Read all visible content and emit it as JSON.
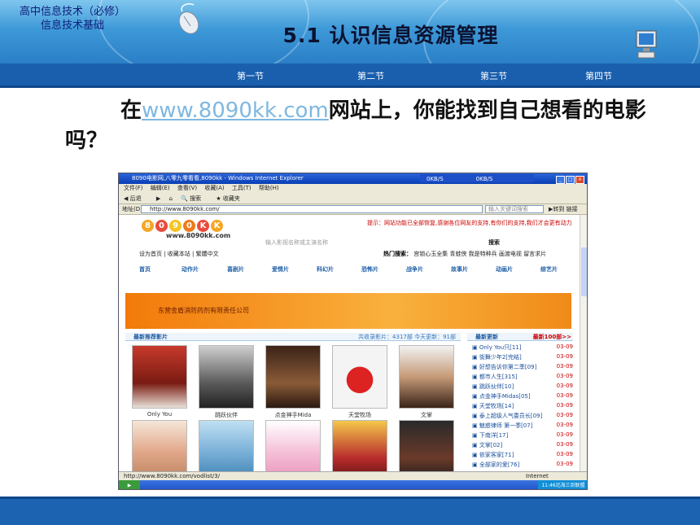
{
  "header": {
    "course_line1": "高中信息技术（必修）",
    "course_line2": "信息技术基础",
    "title": "5.1 认识信息资源管理"
  },
  "nav": [
    "第一节",
    "第二节",
    "第三节",
    "第四节"
  ],
  "question": {
    "before": "在",
    "link": "www.8090kk.com",
    "after": "网站上，你能找到自己想看的电影吗？"
  },
  "browser": {
    "window_title": "8090电影网,八零九零看看,8090kk - Windows Internet Explorer",
    "speed_a": "0KB/S",
    "speed_b": "0KB/S",
    "menu": [
      "文件(F)",
      "编辑(E)",
      "查看(V)",
      "收藏(A)",
      "工具(T)",
      "帮助(H)"
    ],
    "toolbar": [
      "后退",
      "搜索",
      "收藏夹"
    ],
    "address_label": "地址(D)",
    "url": "http://www.8090kk.com/",
    "search_placeholder": "输入关键词搜索",
    "go_label": "转到",
    "links_label": "链接",
    "status_url": "http://www.8090kk.com/vodlist/3/",
    "status_zone": "Internet",
    "clock": "11:46北海三剑联盟"
  },
  "site": {
    "domain": "www.8090kk.com",
    "search_placeholder": "输入影视名称或主演名称",
    "search_button": "搜索",
    "tip": "提示：网站功能已全部恢复,感谢各位网友的支持,有你们的支持,我们才会更有动力",
    "subnav": "设为首页 | 收藏本站 | 繁體中文",
    "hot_label": "热门搜索：",
    "hot_items": "宫锁心玉全集  青蛙侠  我是特种兵  画渡电视  留言求片",
    "categories": [
      "首页",
      "动作片",
      "喜剧片",
      "爱情片",
      "科幻片",
      "恐怖片",
      "战争片",
      "故事片",
      "动画片",
      "综艺片"
    ],
    "banner_text": "东营金盾消防药剂有限责任公司",
    "rec_title": "最新推荐影片",
    "rec_stats": "共收录影片：4317部  今天更新：91部",
    "news_title": "最新更新",
    "news_more": "最新100部>>",
    "films": [
      "Only You",
      "跳跃伙伴",
      "点金神手Mida",
      "天堂牧场",
      "文掌"
    ],
    "news": [
      {
        "t": "Only You只[11]",
        "d": "03-09"
      },
      {
        "t": "街舞少年2[完结]",
        "d": "03-09"
      },
      {
        "t": "好想告诉你第二季[09]",
        "d": "03-09"
      },
      {
        "t": "都市人生[315]",
        "d": "03-09"
      },
      {
        "t": "跳跃伙伴[10]",
        "d": "03-09"
      },
      {
        "t": "点金神手Midas[05]",
        "d": "03-09"
      },
      {
        "t": "天堂牧场[14]",
        "d": "03-09"
      },
      {
        "t": "泰上超级人气委员长[09]",
        "d": "03-09"
      },
      {
        "t": "魅惑律师 第一季[07]",
        "d": "03-09"
      },
      {
        "t": "下南洋[17]",
        "d": "03-09"
      },
      {
        "t": "文掌[02]",
        "d": "03-09"
      },
      {
        "t": "依家客家[71]",
        "d": "03-09"
      },
      {
        "t": "全部家的爱[76]",
        "d": "03-09"
      }
    ]
  },
  "colors": {
    "nav": "#1a5fae",
    "footer": "#1c63b2",
    "link": "#7fb8e0"
  }
}
